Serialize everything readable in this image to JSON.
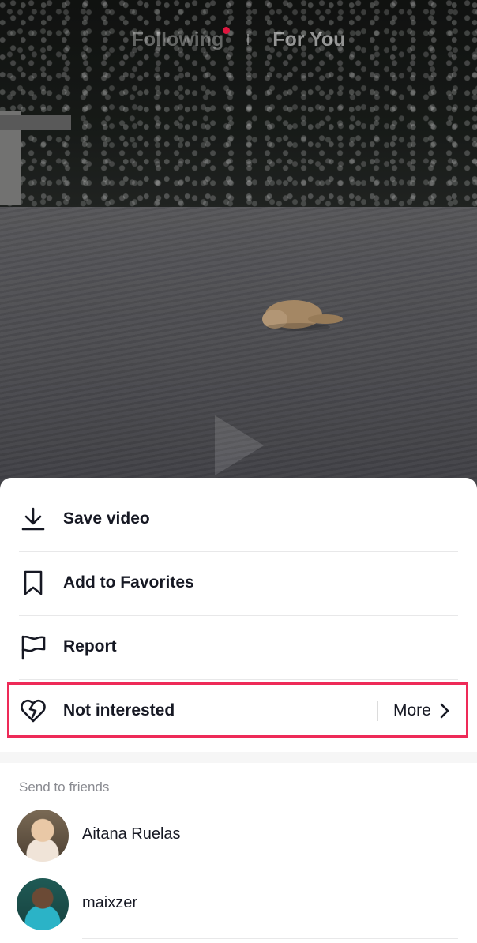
{
  "top_tabs": {
    "following_label": "Following",
    "for_you_label": "For You"
  },
  "menu": {
    "save_video": "Save video",
    "add_to_favorites": "Add to Favorites",
    "report": "Report",
    "not_interested": "Not interested",
    "more": "More"
  },
  "friends": {
    "header": "Send to friends",
    "list": [
      {
        "name": "Aitana Ruelas"
      },
      {
        "name": "maixzer"
      }
    ]
  },
  "colors": {
    "highlight": "#ee2a58",
    "text": "#161823",
    "live_dot": "#e0163f"
  },
  "icons": [
    "download-icon",
    "bookmark-icon",
    "flag-icon",
    "broken-heart-icon",
    "chevron-right-icon",
    "play-icon"
  ]
}
